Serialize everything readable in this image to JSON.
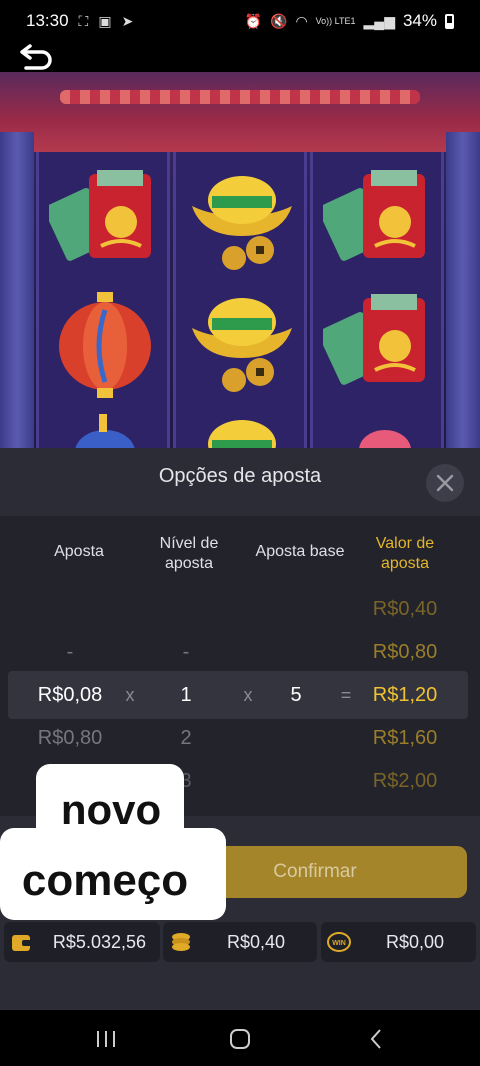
{
  "status_bar": {
    "time": "13:30",
    "battery": "34%",
    "network_label": "Vo)) LTE1"
  },
  "sheet": {
    "title": "Opções de aposta"
  },
  "columns": {
    "aposta": "Aposta",
    "nivel": "Nível de aposta",
    "base": "Aposta base",
    "valor": "Valor de aposta"
  },
  "rows": [
    {
      "aposta": "",
      "nivel": "",
      "base": "",
      "valor": "R$0,40"
    },
    {
      "aposta": "-",
      "nivel": "-",
      "base": "",
      "valor": "R$0,80"
    },
    {
      "aposta": "R$0,08",
      "nivel": "1",
      "base": "5",
      "valor": "R$1,20",
      "op1": "x",
      "op2": "x",
      "op3": "="
    },
    {
      "aposta": "R$0,80",
      "nivel": "2",
      "base": "",
      "valor": "R$1,60"
    },
    {
      "aposta": "",
      "nivel": "3",
      "base": "",
      "valor": "R$2,00"
    }
  ],
  "confirm_label": "Confirmar",
  "info": {
    "balance": "R$5.032,56",
    "bet": "R$0,40",
    "win": "R$0,00",
    "win_icon_text": "WIN"
  },
  "overlay": {
    "line1": "novo",
    "line2": "começo"
  },
  "colors": {
    "accent_gold": "#f0c233",
    "sheet_bg": "#2b2c35",
    "confirm_bg": "#a4852a"
  },
  "icons": {
    "back": "back-arrow-icon",
    "close": "close-icon",
    "wallet": "wallet-icon",
    "coins": "coins-icon",
    "win": "win-icon"
  }
}
